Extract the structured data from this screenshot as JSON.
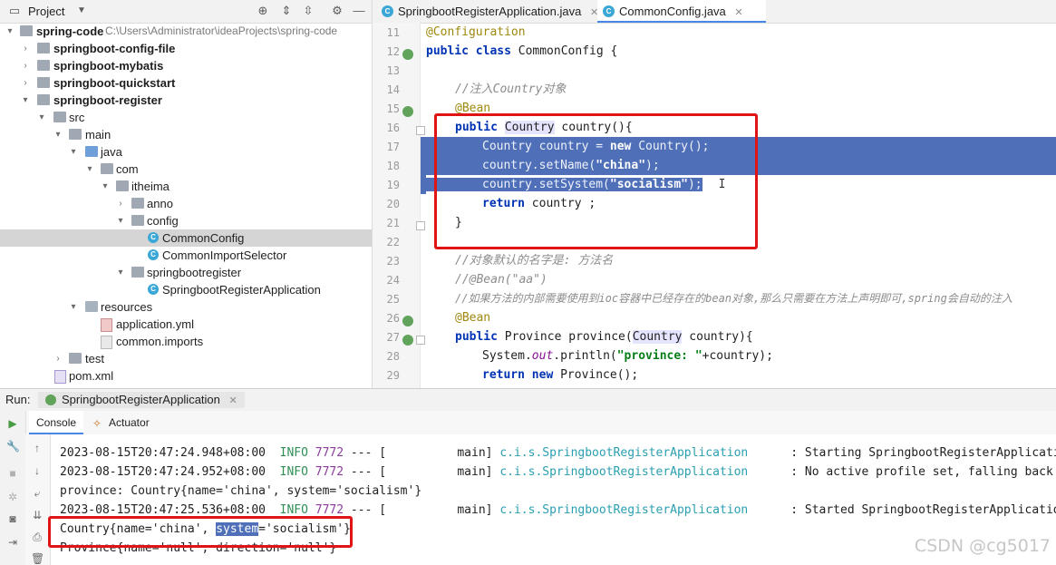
{
  "project_panel": {
    "title": "Project",
    "tree": [
      {
        "label": "spring-code",
        "hint": "C:\\Users\\Administrator\\ideaProjects\\spring-code",
        "bold": true
      },
      {
        "label": "springboot-config-file",
        "bold": true
      },
      {
        "label": "springboot-mybatis",
        "bold": true
      },
      {
        "label": "springboot-quickstart",
        "bold": true
      },
      {
        "label": "springboot-register",
        "bold": true
      },
      {
        "label": "src"
      },
      {
        "label": "main"
      },
      {
        "label": "java"
      },
      {
        "label": "com"
      },
      {
        "label": "itheima"
      },
      {
        "label": "anno"
      },
      {
        "label": "config"
      },
      {
        "label": "CommonConfig"
      },
      {
        "label": "CommonImportSelector"
      },
      {
        "label": "springbootregister"
      },
      {
        "label": "SpringbootRegisterApplication"
      },
      {
        "label": "resources"
      },
      {
        "label": "application.yml"
      },
      {
        "label": "common.imports"
      },
      {
        "label": "test"
      },
      {
        "label": "pom.xml"
      }
    ]
  },
  "editor": {
    "tabs": [
      {
        "label": "SpringbootRegisterApplication.java"
      },
      {
        "label": "CommonConfig.java",
        "active": true
      }
    ],
    "line_numbers": [
      "11",
      "12",
      "13",
      "14",
      "15",
      "16",
      "17",
      "18",
      "19",
      "20",
      "21",
      "22",
      "23",
      "24",
      "25",
      "26",
      "27",
      "28",
      "29"
    ],
    "code": {
      "l11": "@Configuration",
      "l12_kw": "public class ",
      "l12_rest": "CommonConfig {",
      "l14": "//注入Country对象",
      "l15": "@Bean",
      "l16_kw": "public ",
      "l16_type": "Country",
      "l16_rest": " country(){",
      "l17_a": "Country country = ",
      "l17_kw": "new ",
      "l17_b": "Country();",
      "l18_a": "country.setName(",
      "l18_str": "\"china\"",
      "l18_b": ");",
      "l19_a": "country.setSystem(",
      "l19_str": "\"socialism\"",
      "l19_b": ");",
      "l20_kw": "return ",
      "l20_rest": "country ;",
      "l21": "}",
      "l23": "//对象默认的名字是: 方法名",
      "l24": "//@Bean(\"aa\")",
      "l25": "//如果方法的内部需要使用到ioc容器中已经存在的bean对象,那么只需要在方法上声明即可,spring会自动的注入",
      "l26": "@Bean",
      "l27_kw": "public ",
      "l27_a": "Province province(",
      "l27_type": "Country",
      "l27_b": " country){",
      "l28_a": "System.",
      "l28_fld": "out",
      "l28_b": ".println(",
      "l28_str": "\"province: \"",
      "l28_c": "+country);",
      "l29_kw": "return new ",
      "l29_rest": "Province();"
    }
  },
  "run": {
    "label": "Run:",
    "config": "SpringbootRegisterApplication",
    "tabs": [
      {
        "label": "Console",
        "active": true
      },
      {
        "label": "Actuator"
      }
    ]
  },
  "console": [
    {
      "ts": "2023-08-15T20:47:24.948+08:00",
      "level": "INFO",
      "pid": "7772",
      "sep": "--- [",
      "thread": "main]",
      "logger": "c.i.s.SpringbootRegisterApplication",
      "msg": ": Starting SpringbootRegisterApplicatio"
    },
    {
      "ts": "2023-08-15T20:47:24.952+08:00",
      "level": "INFO",
      "pid": "7772",
      "sep": "--- [",
      "thread": "main]",
      "logger": "c.i.s.SpringbootRegisterApplication",
      "msg": ": No active profile set, falling back t"
    },
    {
      "text": "province: Country{name='china', system='socialism'}"
    },
    {
      "ts": "2023-08-15T20:47:25.536+08:00",
      "level": "INFO",
      "pid": "7772",
      "sep": "--- [",
      "thread": "main]",
      "logger": "c.i.s.SpringbootRegisterApplication",
      "msg": ": Started SpringbootRegisterApplicatio"
    },
    {
      "a": "Country{name='china', ",
      "sel": "system",
      "b": "='socialism'}"
    },
    {
      "text": "Province{name='null', direction='null'}"
    }
  ],
  "watermark": "CSDN @cg5017",
  "colors": {
    "selection": "#4f6fb8",
    "annotation_box": "#e01414",
    "keyword": "#0033b3",
    "string": "#067d17"
  }
}
